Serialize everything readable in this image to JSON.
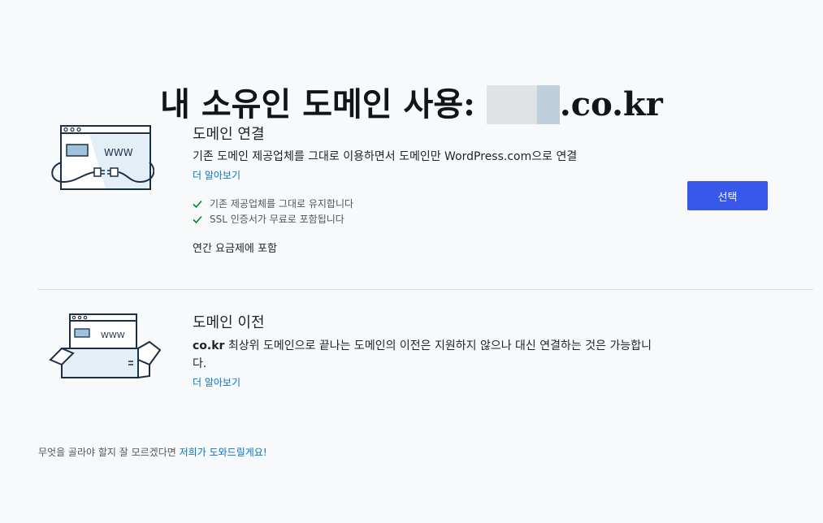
{
  "page": {
    "title_prefix": "내 소유인 도메인 사용:",
    "title_domain_suffix": ".co.kr"
  },
  "connect": {
    "title": "도메인 연결",
    "description": "기존 도메인 제공업체를 그대로 이용하면서 도메인만 WordPress.com으로 연결",
    "learn_more": "더 알아보기",
    "features": [
      "기존 제공업체를 그대로 유지합니다",
      "SSL 인증서가 무료로 포함됩니다"
    ],
    "price_note": "연간 요금제에 포함",
    "select_label": "선택",
    "illustration_text": "WWW",
    "icon": "browser-plug-illustration"
  },
  "transfer": {
    "title": "도메인 이전",
    "description_strong": "co.kr",
    "description_rest": " 최상위 도메인으로 끝나는 도메인의 이전은 지원하지 않으나 대신 연결하는 것은 가능합니다.",
    "learn_more": "더 알아보기",
    "illustration_text": "WWW",
    "icon": "browser-box-illustration"
  },
  "footer": {
    "text": "무엇을 골라야 할지 잘 모르겠다면 ",
    "link": "저희가 도와드릴게요!"
  },
  "colors": {
    "accent": "#3858e9",
    "link": "#0675c4",
    "check": "#008a20",
    "illustration_fill": "#e3eef7",
    "illustration_stroke": "#1d2f45"
  }
}
